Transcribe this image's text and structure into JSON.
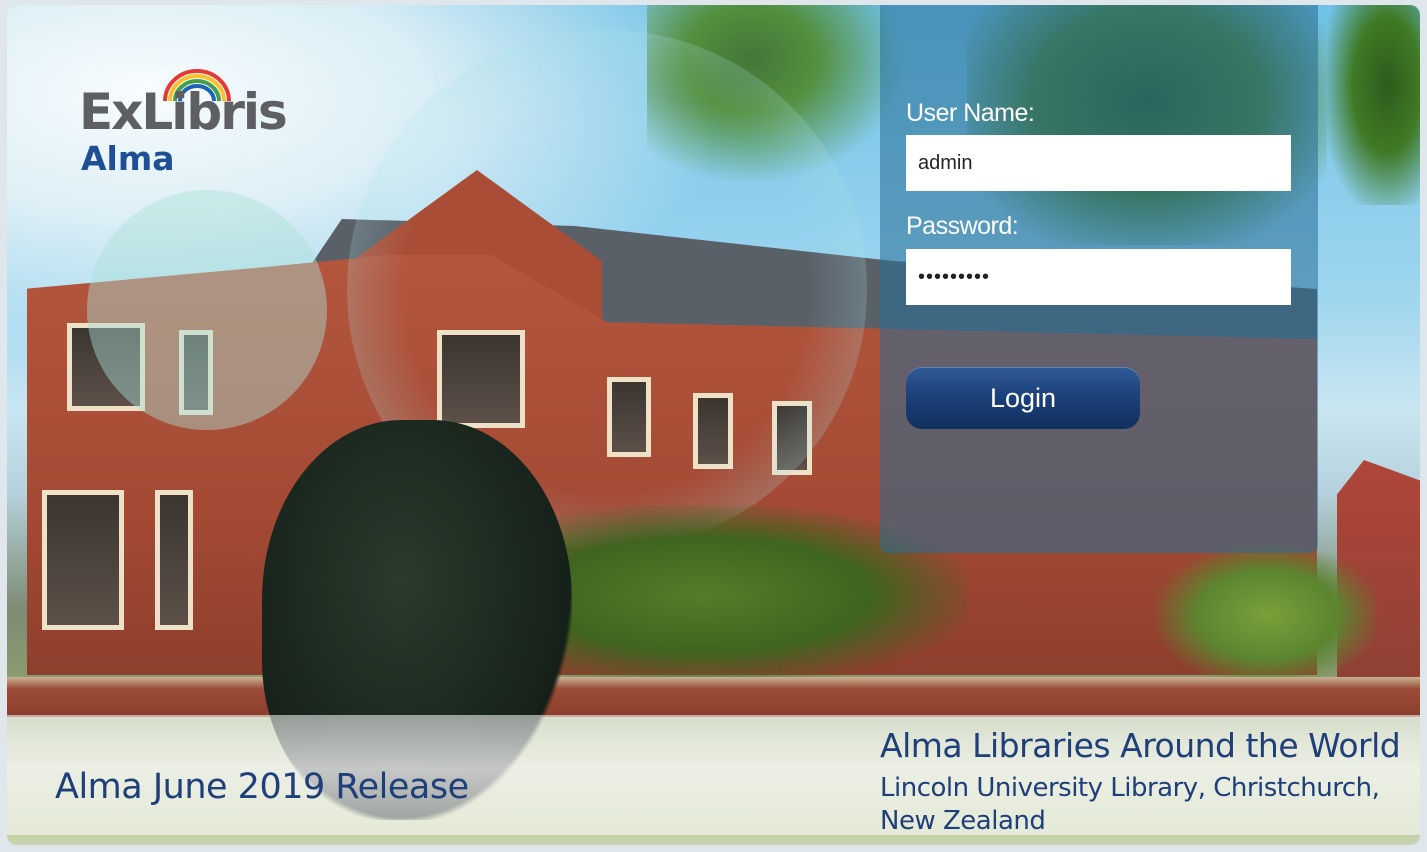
{
  "logo": {
    "brand_text": "ExLibris",
    "product_text": "Alma",
    "icon": "rainbow-arc-icon"
  },
  "login": {
    "username_label": "User Name:",
    "username_value": "admin",
    "password_label": "Password:",
    "password_value": "•••••••••",
    "login_button_label": "Login"
  },
  "footer": {
    "release_text": "Alma June 2019 Release",
    "caption_title": "Alma Libraries Around the World",
    "caption_line1": "Lincoln University Library, Christchurch,",
    "caption_line2": "New Zealand"
  },
  "colors": {
    "brand_blue": "#1f4f94",
    "logo_gray": "#5d5f62",
    "button_navy": "#1b3f78",
    "panel_teal": "#286e96",
    "caption_navy": "#1f3f7a"
  }
}
